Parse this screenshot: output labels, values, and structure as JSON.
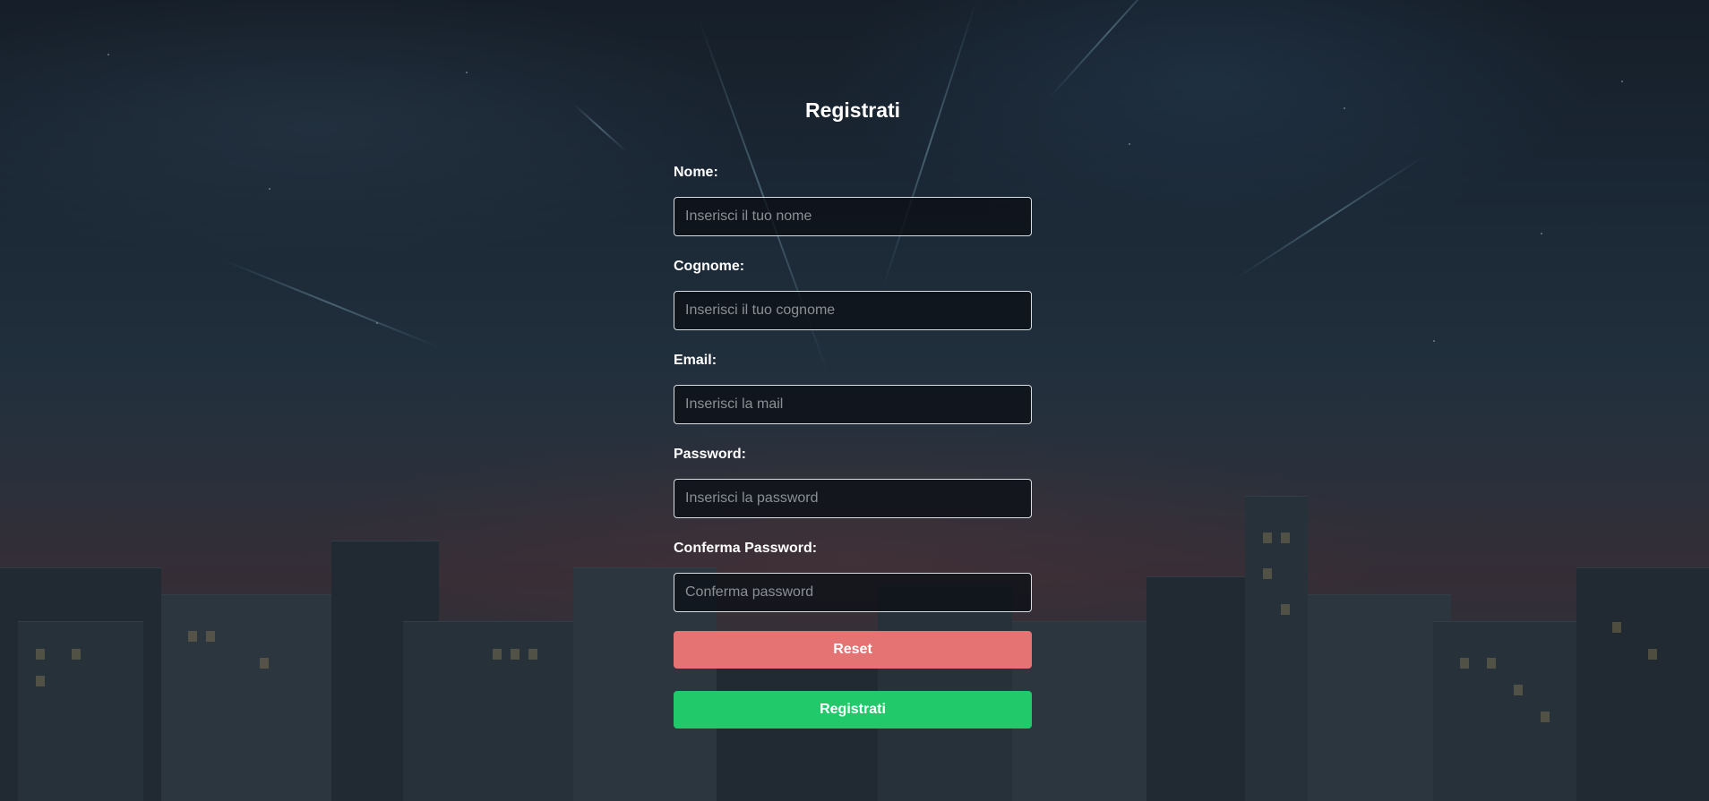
{
  "form": {
    "title": "Registrati",
    "fields": [
      {
        "label": "Nome:",
        "placeholder": "Inserisci il tuo nome",
        "value": ""
      },
      {
        "label": "Cognome:",
        "placeholder": "Inserisci il tuo cognome",
        "value": ""
      },
      {
        "label": "Email:",
        "placeholder": "Inserisci la mail",
        "value": ""
      },
      {
        "label": "Password:",
        "placeholder": "Inserisci la password",
        "value": ""
      },
      {
        "label": "Conferma Password:",
        "placeholder": "Conferma password",
        "value": ""
      }
    ],
    "reset_label": "Reset",
    "submit_label": "Registrati"
  },
  "colors": {
    "reset_button": "#e57373",
    "submit_button": "#22c96a",
    "input_border": "#d8dde2",
    "text": "#ffffff"
  }
}
